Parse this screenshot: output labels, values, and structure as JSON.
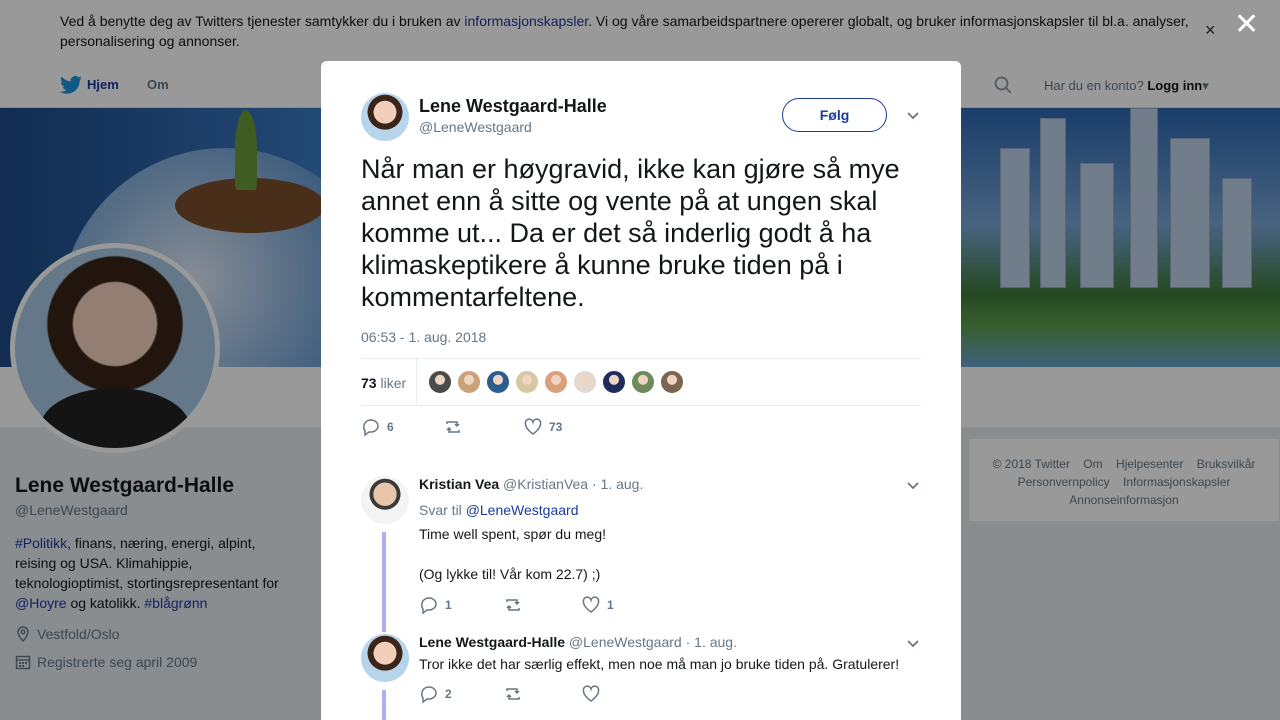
{
  "cookie_bar": {
    "text_before": "Ved å benytte deg av Twitters tjenester samtykker du i bruken av ",
    "link": "informasjonskapsler",
    "text_after": ". Vi og våre samarbeidspartnere opererer globalt, og bruker informasjonskapsler til bl.a. analyser, personalisering og annonser.",
    "close_glyph": "×"
  },
  "nav": {
    "home": "Hjem",
    "about": "Om",
    "login_prompt": "Har du en konto?",
    "login": "Logg inn",
    "caret": "▾"
  },
  "profile": {
    "name": "Lene Westgaard-Halle",
    "handle": "@LeneWestgaard",
    "bio_tag1": "#Politikk",
    "bio_text1": ", finans, næring, energi, alpint, reising og USA. Klimahippie, teknologioptimist, stortingsrepresentant for ",
    "bio_mention": "@Hoyre",
    "bio_text2": " og katolikk. ",
    "bio_tag2": "#blågrønn",
    "location": "Vestfold/Oslo",
    "joined": "Registrerte seg april 2009"
  },
  "footer": {
    "links": [
      "© 2018 Twitter",
      "Om",
      "Hjelpesenter",
      "Bruksvilkår",
      "Personvernpolicy",
      "Informasjonskapsler",
      "Annonseinformasjon"
    ]
  },
  "overlay_close": "✕",
  "tweet": {
    "author_name": "Lene Westgaard-Halle",
    "author_handle": "@LeneWestgaard",
    "follow_label": "Følg",
    "text": "Når man er høygravid, ikke kan gjøre så mye annet enn å sitte og vente på at ungen skal komme ut... Da er det så inderlig godt å ha klimaskeptikere å kunne bruke tiden på i kommentarfeltene.",
    "timestamp": "06:53 - 1. aug. 2018",
    "like_count": "73",
    "likes_label": "liker",
    "reply_count": "6",
    "retweet_count": "",
    "favorite_count": "73",
    "liker_colors": [
      "#4a4a4a",
      "#c9a27a",
      "#2c5d8f",
      "#d8c7a4",
      "#d9a07b",
      "#e4d9d0",
      "#1f2d5c",
      "#6d8a5b",
      "#7a6650"
    ]
  },
  "replies": [
    {
      "name": "Kristian Vea",
      "handle": "@KristianVea",
      "date": "· 1. aug.",
      "reply_to_label": "Svar til",
      "reply_to": "@LeneWestgaard",
      "line1": "Time well spent, spør du meg!",
      "line2": "(Og lykke til! Vår kom 22.7) ;)",
      "reply_count": "1",
      "retweet_count": "",
      "like_count": "1"
    },
    {
      "name": "Lene Westgaard-Halle",
      "handle": "@LeneWestgaard",
      "date": "· 1. aug.",
      "line1": "Tror ikke det har særlig effekt, men noe må man jo bruke tiden på. Gratulerer!",
      "reply_count": "2",
      "retweet_count": "",
      "like_count": ""
    }
  ],
  "colors": {
    "link": "#1b3a9c",
    "thread_line": "#aab3f0",
    "muted": "#657786"
  }
}
